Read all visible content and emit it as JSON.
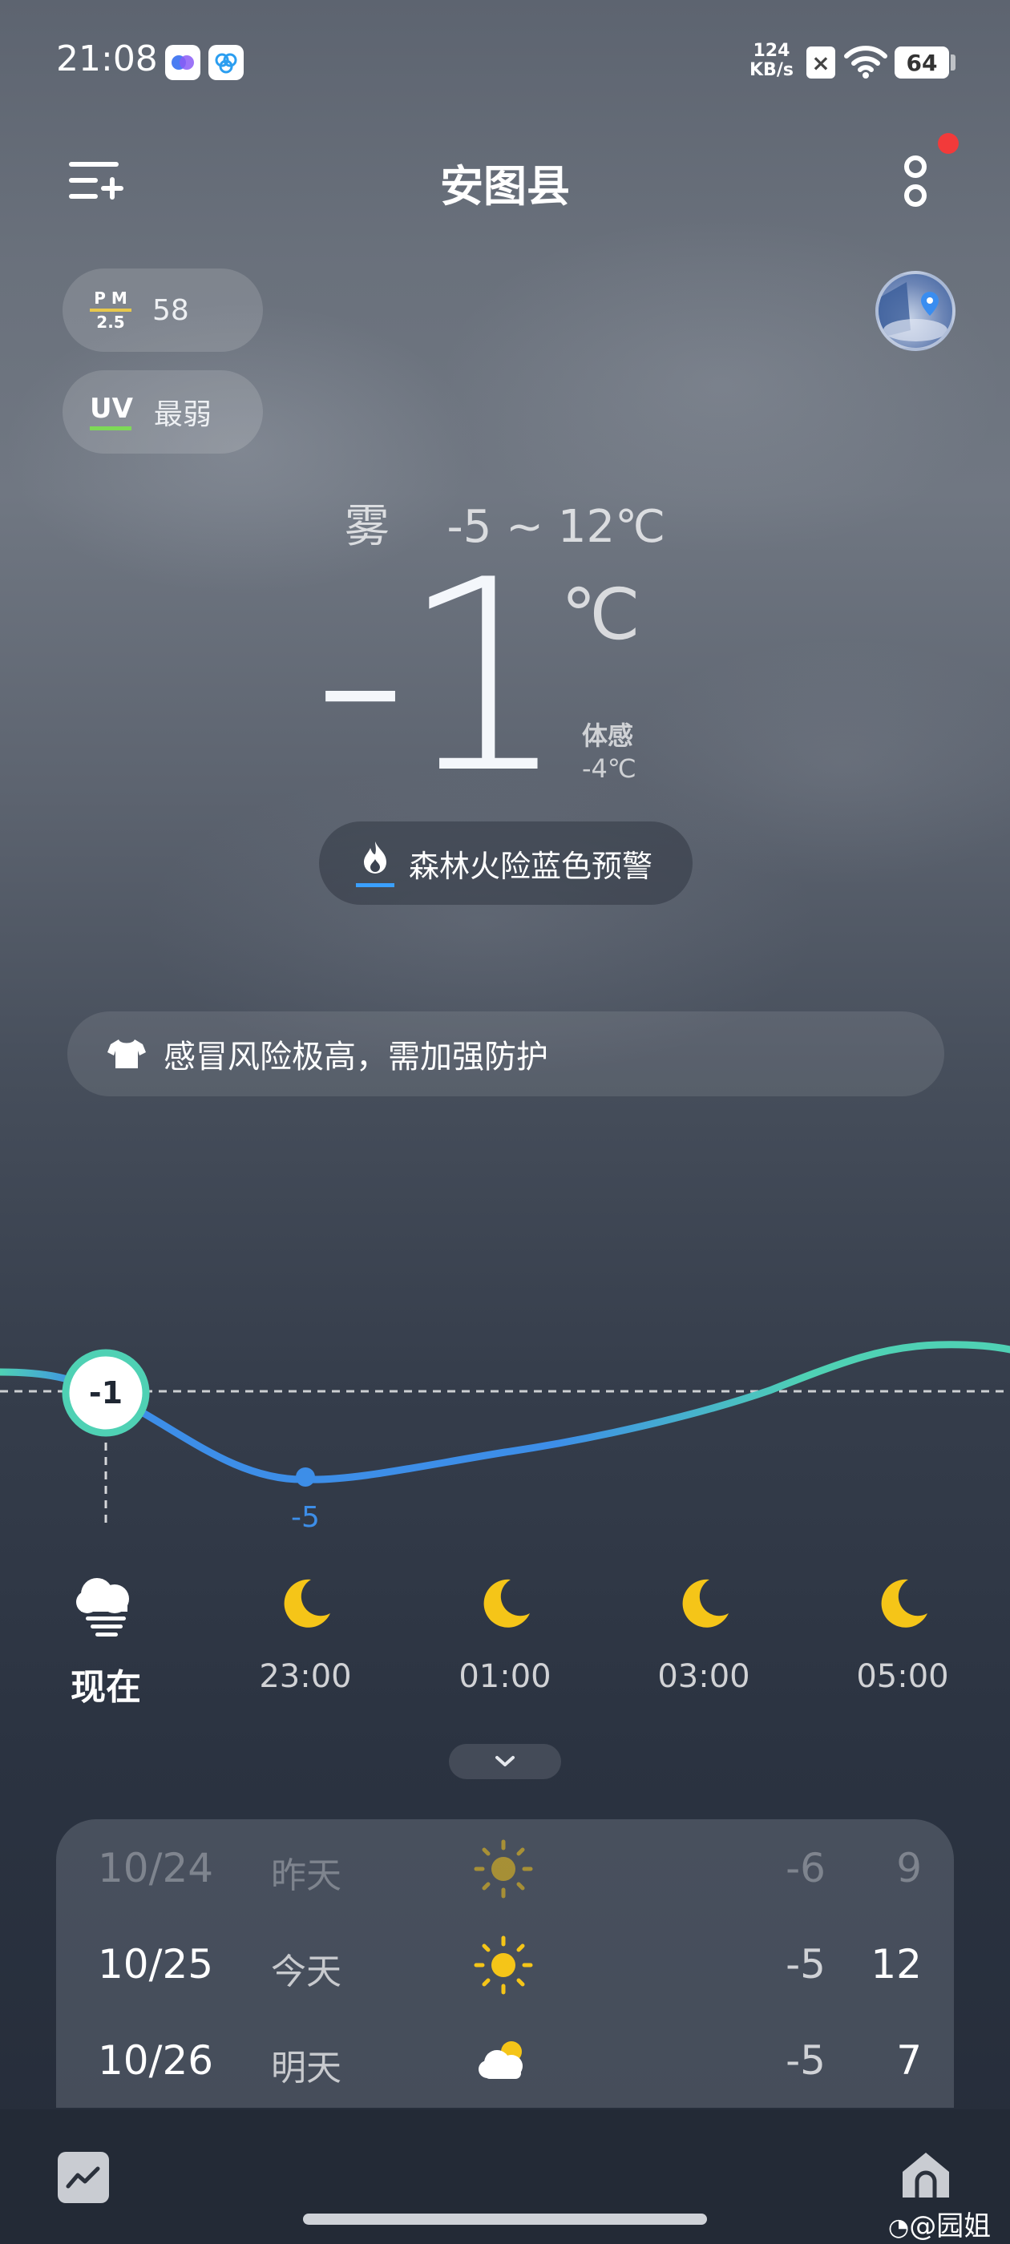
{
  "status_bar": {
    "time": "21:08",
    "net_speed_value": "124",
    "net_speed_unit": "KB/s",
    "battery": "64"
  },
  "header": {
    "city": "安图县",
    "menu_icon": "list-add-icon",
    "more_icon": "more-vertical-icon",
    "notification_dot_color": "#f23a3a"
  },
  "air": {
    "pm_label_top": "P M",
    "pm_label_bottom": "2.5",
    "pm_value": "58",
    "uv_label": "UV",
    "uv_value": "最弱",
    "uv_accent": "#7ed957"
  },
  "current": {
    "condition": "雾",
    "range": "-5 ~ 12℃",
    "temp": "-1",
    "unit": "℃",
    "feels_label": "体感",
    "feels_value": "-4℃"
  },
  "alert": {
    "text": "森林火险蓝色预警",
    "icon": "flame-icon",
    "level_color": "#3aa0ff"
  },
  "health": {
    "text": "感冒风险极高，需加强防护",
    "icon": "shirt-icon"
  },
  "hourly": {
    "current_value": "-1",
    "min_label": "-5",
    "items": [
      {
        "time": "现在",
        "icon": "fog-cloud-icon"
      },
      {
        "time": "23:00",
        "icon": "moon-icon"
      },
      {
        "time": "01:00",
        "icon": "moon-icon"
      },
      {
        "time": "03:00",
        "icon": "moon-icon"
      },
      {
        "time": "05:00",
        "icon": "moon-icon"
      }
    ]
  },
  "daily": [
    {
      "date": "10/24",
      "day": "昨天",
      "icon": "sun-icon",
      "low": "-6",
      "high": "9"
    },
    {
      "date": "10/25",
      "day": "今天",
      "icon": "sun-icon",
      "low": "-5",
      "high": "12"
    },
    {
      "date": "10/26",
      "day": "明天",
      "icon": "partly-cloudy-icon",
      "low": "-5",
      "high": "7"
    }
  ],
  "watermark": "@园姐",
  "colors": {
    "curve_start": "#3d8ee8",
    "curve_end": "#4fd1b4",
    "sun": "#f5c518",
    "moon": "#f5c518"
  }
}
